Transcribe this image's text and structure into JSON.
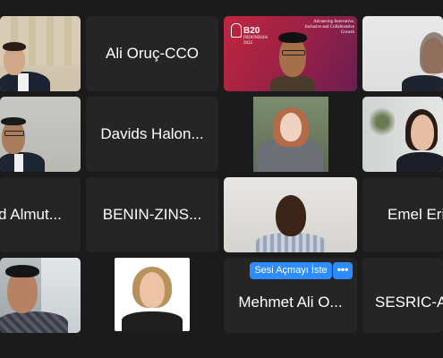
{
  "participants": [
    {
      "id": "video-1",
      "name": ""
    },
    {
      "id": "ali",
      "name": "Ali Oruç-CCO"
    },
    {
      "id": "video-b20",
      "name": ""
    },
    {
      "id": "video-4",
      "name": ""
    },
    {
      "id": "video-5",
      "name": ""
    },
    {
      "id": "davids",
      "name": "Davids Halon..."
    },
    {
      "id": "video-7",
      "name": ""
    },
    {
      "id": "video-8",
      "name": ""
    },
    {
      "id": "almut",
      "name": "d Almut..."
    },
    {
      "id": "benin",
      "name": "BENIN-ZINS..."
    },
    {
      "id": "video-11",
      "name": ""
    },
    {
      "id": "emel",
      "name": "Emel Eri"
    },
    {
      "id": "video-13",
      "name": ""
    },
    {
      "id": "video-14",
      "name": ""
    },
    {
      "id": "mehmet",
      "name": "Mehmet Ali O..."
    },
    {
      "id": "sesric",
      "name": "SESRIC-A"
    }
  ],
  "b20_banner": {
    "tagline": "Advancing Innovative, Inclusive and Collaborative Growth",
    "logo": "B20",
    "sub": "INDONESIA 2022"
  },
  "tile_actions": {
    "unmute_label": "Sesi Açmayı İste",
    "more_label": "•••"
  },
  "colors": {
    "background": "#1b1b1b",
    "tile": "#242424",
    "accent": "#2d8cff"
  }
}
